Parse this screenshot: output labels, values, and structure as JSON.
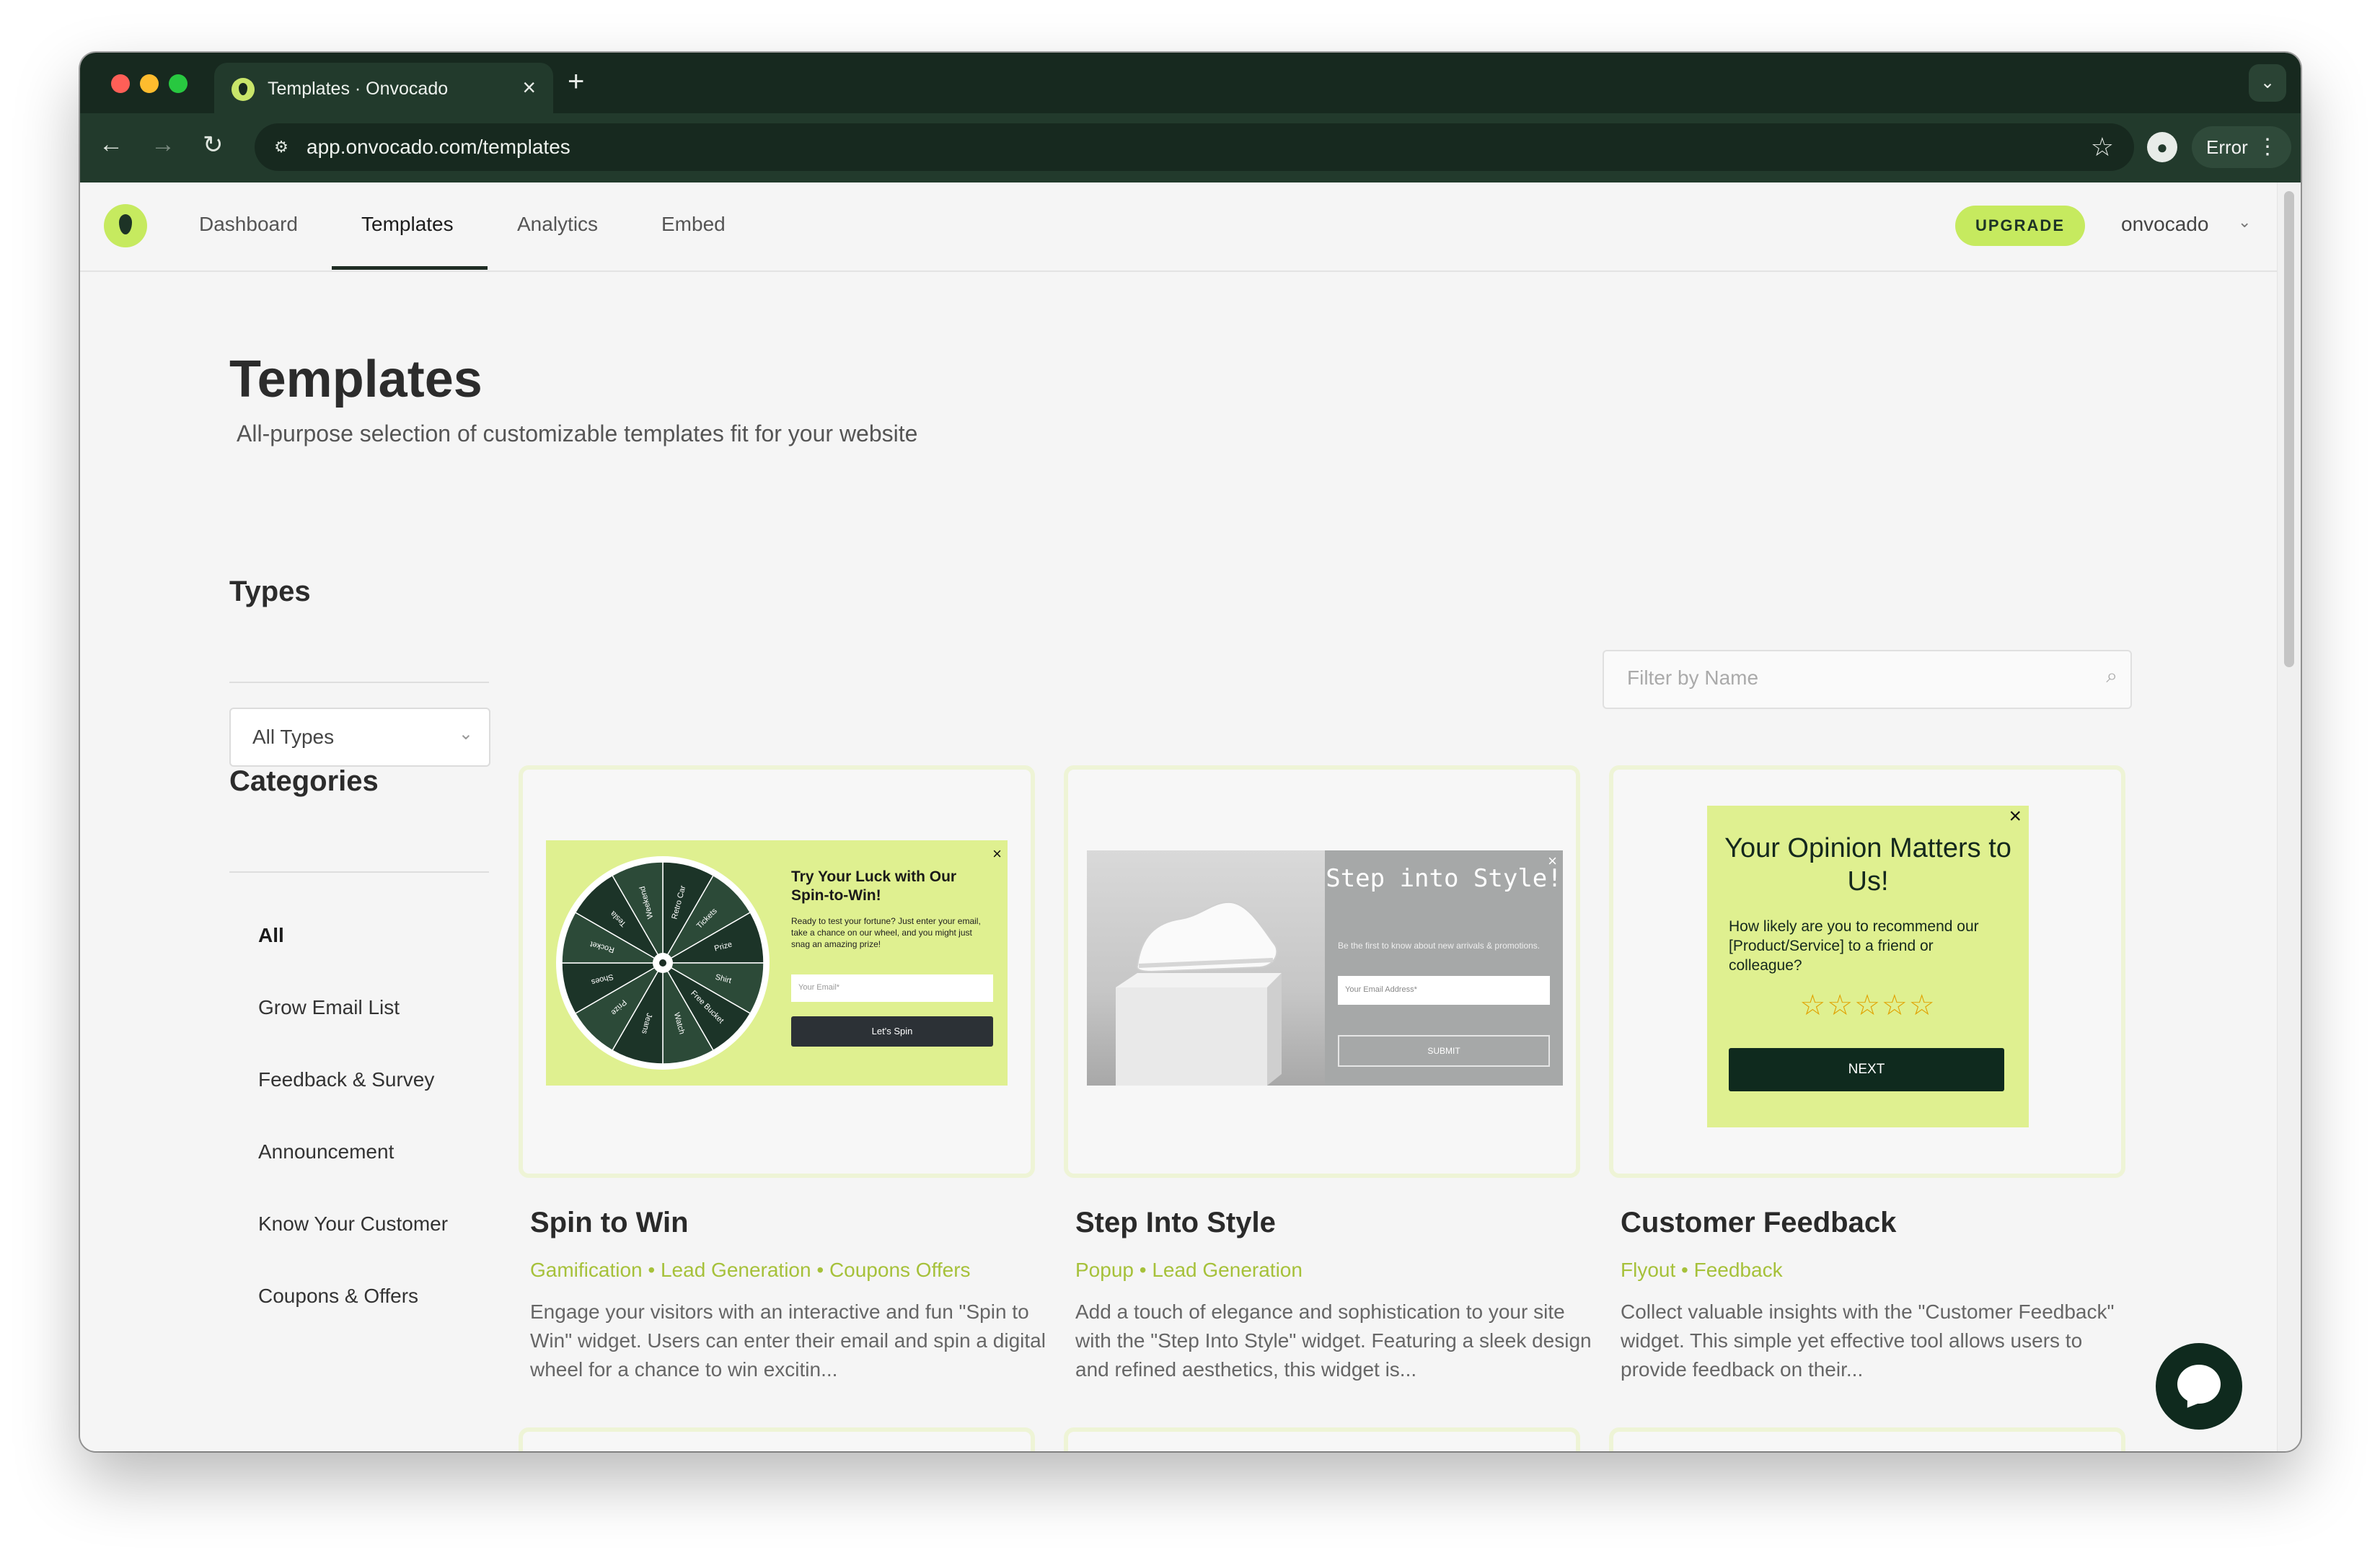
{
  "browser": {
    "tab_title": "Templates · Onvocado",
    "tab_close": "×",
    "new_tab": "+",
    "url": "app.onvocado.com/templates",
    "error_label": "Error"
  },
  "nav": {
    "links": [
      "Dashboard",
      "Templates",
      "Analytics",
      "Embed"
    ],
    "upgrade": "UPGRADE",
    "username": "onvocado"
  },
  "page": {
    "title": "Templates",
    "subtitle": "All-purpose selection of customizable templates fit for your website"
  },
  "sidebar": {
    "types_heading": "Types",
    "types_selected": "All Types",
    "categories_heading": "Categories",
    "categories": [
      "All",
      "Grow Email List",
      "Feedback & Survey",
      "Announcement",
      "Know Your Customer",
      "Coupons & Offers"
    ]
  },
  "filter": {
    "placeholder": "Filter by Name"
  },
  "templates": [
    {
      "title": "Spin to Win",
      "tags": "Gamification •  Lead Generation •  Coupons Offers",
      "description": "Engage your visitors with an interactive and fun \"Spin to Win\" widget. Users can enter their email and spin a digital wheel for a chance to win excitin...",
      "preview": {
        "heading": "Try Your Luck with Our Spin-to-Win!",
        "body": "Ready to test your fortune? Just enter your email, take a chance on our wheel, and you might just snag an amazing prize!",
        "input_placeholder": "Your Email*",
        "button": "Let's Spin",
        "close": "×",
        "wheel_labels": [
          "Retro Car",
          "Tickets",
          "Prize",
          "Shirt",
          "Free Bucket",
          "Watch",
          "Jeans",
          "Prize",
          "Shoes",
          "Rocket",
          "Tesla",
          "Weekend"
        ]
      }
    },
    {
      "title": "Step Into Style",
      "tags": "Popup •  Lead Generation",
      "description": "Add a touch of elegance and sophistication to your site with the \"Step Into Style\" widget. Featuring a sleek design and refined aesthetics, this widget is...",
      "preview": {
        "heading": "Step into Style!",
        "body": "Be the first to know about new arrivals & promotions.",
        "input_placeholder": "Your Email Address*",
        "button": "SUBMIT",
        "close": "×"
      }
    },
    {
      "title": "Customer Feedback",
      "tags": "Flyout •  Feedback",
      "description": "Collect valuable insights with the \"Customer Feedback\" widget. This simple yet effective tool allows users to provide feedback on their...",
      "preview": {
        "heading": "Your Opinion Matters to Us!",
        "body": "How likely are you to recommend our [Product/Service] to a friend or colleague?",
        "stars": "☆☆☆☆☆",
        "button": "NEXT",
        "close": "×"
      }
    }
  ],
  "partial": {
    "close": "×"
  },
  "colors": {
    "brand_green": "#c6ea5f",
    "dark_green": "#0f2a1e",
    "tag_green": "#a6c13a"
  }
}
